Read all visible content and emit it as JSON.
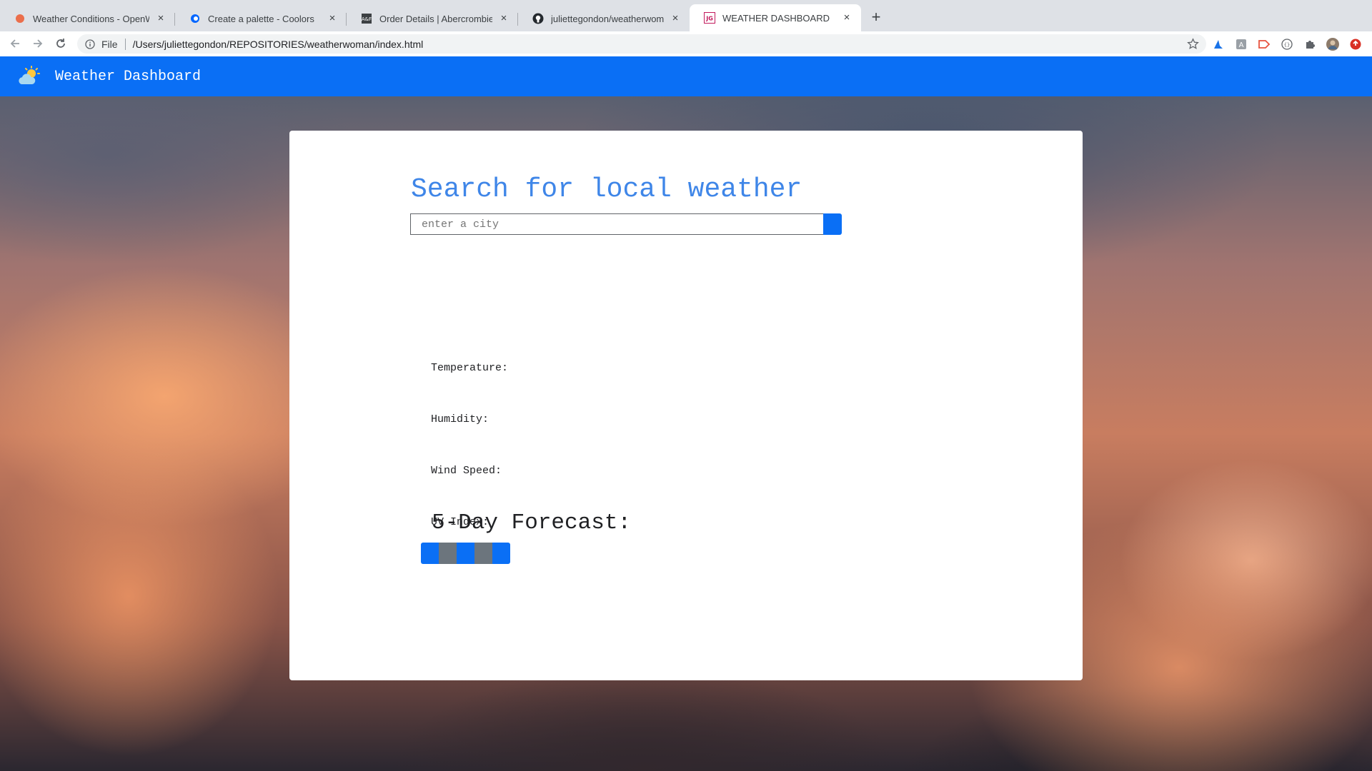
{
  "browser": {
    "tabs": [
      {
        "title": "Weather Conditions - OpenWeather",
        "favicon": "openweather-icon",
        "active": false
      },
      {
        "title": "Create a palette - Coolors",
        "favicon": "coolors-icon",
        "active": false
      },
      {
        "title": "Order Details | Abercrombie.com",
        "favicon": "abercrombie-icon",
        "active": false
      },
      {
        "title": "juliettegondon/weatherwoman",
        "favicon": "github-icon",
        "active": false
      },
      {
        "title": "WEATHER DASHBOARD",
        "favicon": "jg-icon",
        "active": true
      }
    ],
    "address": {
      "scheme": "File",
      "url": "/Users/juliettegondon/REPOSITORIES/weatherwoman/index.html"
    }
  },
  "navbar": {
    "brand": "Weather Dashboard",
    "logo_icon": "sun-cloud-icon"
  },
  "search": {
    "heading": "Search for local weather",
    "placeholder": "enter a city"
  },
  "current": {
    "temperature_label": "Temperature:",
    "humidity_label": "Humidity:",
    "wind_label": "Wind Speed:",
    "uv_label": "UV Index:"
  },
  "forecast": {
    "title": "5-Day Forecast:",
    "days": [
      "blue",
      "gray",
      "blue",
      "gray",
      "blue"
    ]
  },
  "colors": {
    "primary": "#0a6ff5",
    "heading": "#3f86e8",
    "secondary": "#6c757d"
  }
}
